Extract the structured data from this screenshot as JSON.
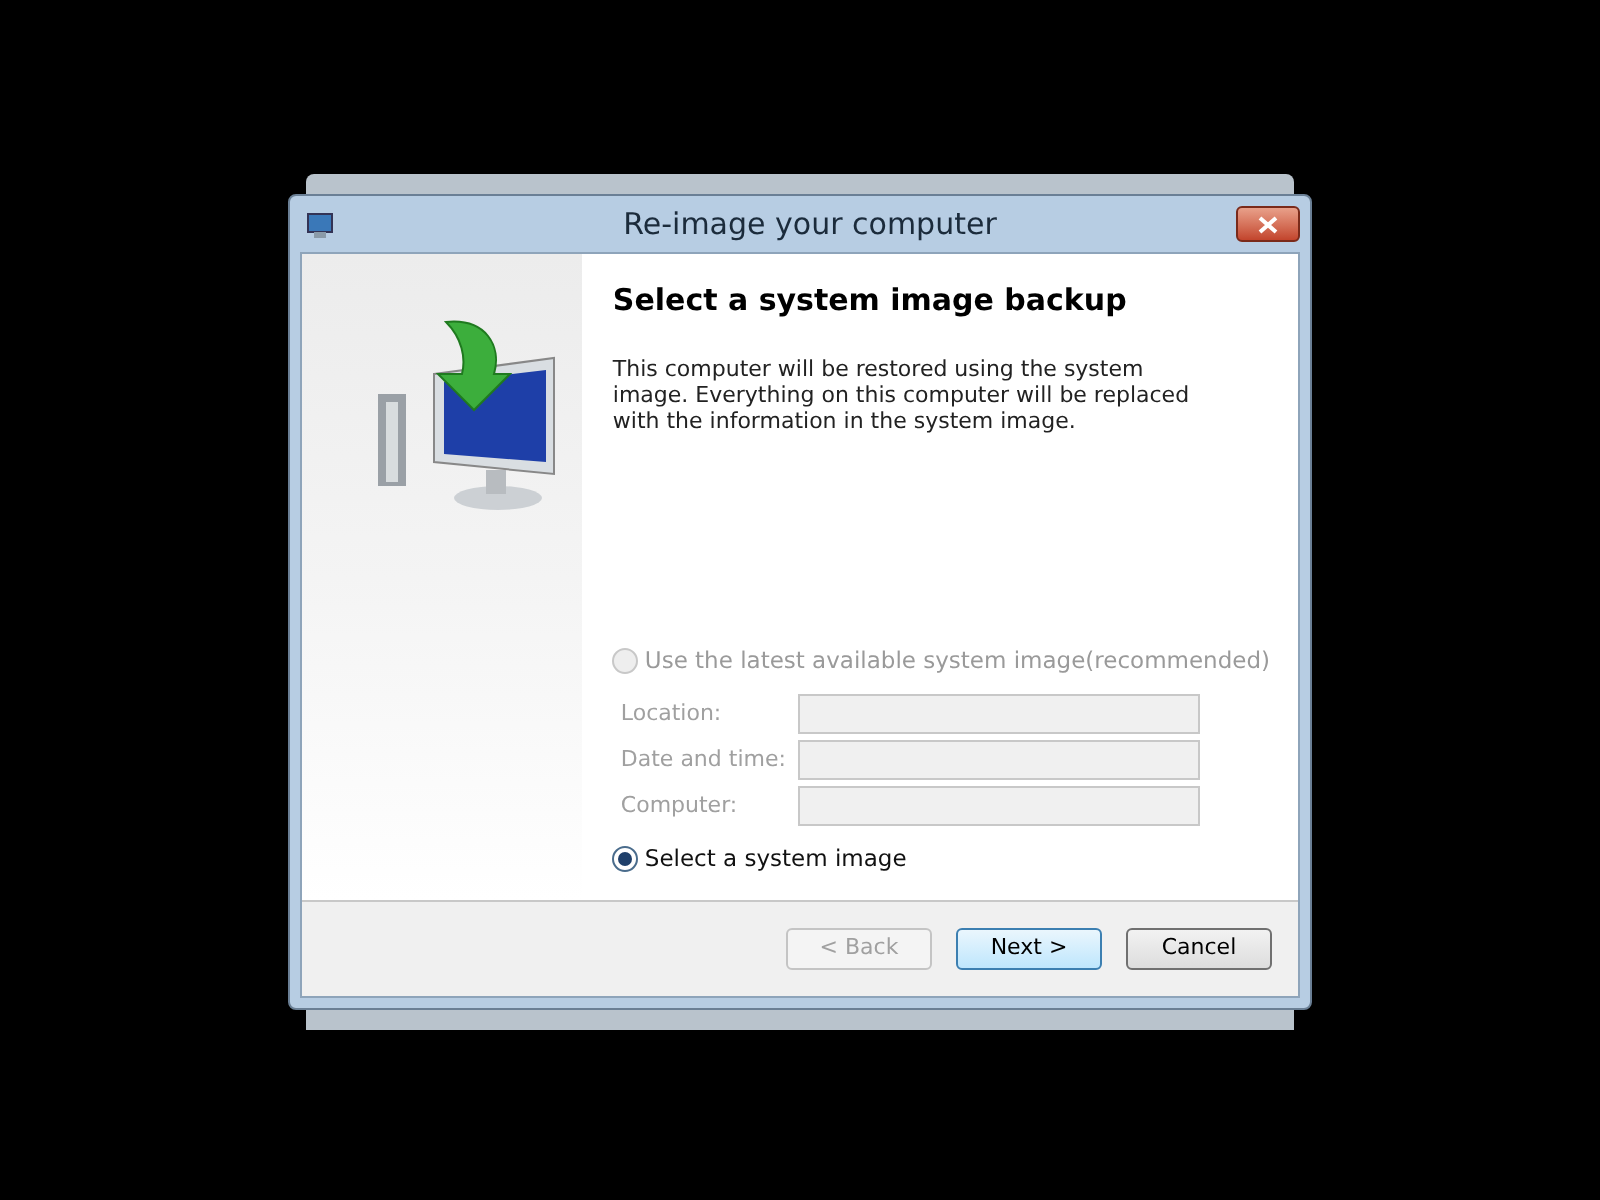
{
  "window": {
    "title": "Re-image your computer"
  },
  "heading": "Select a system image backup",
  "description": "This computer will be restored using the system image. Everything on this computer will be replaced with the information in the system image.",
  "options": [
    {
      "label": "Use the latest available system image(recommended)",
      "selected": false,
      "disabled": true
    },
    {
      "label": "Select a system image",
      "selected": true,
      "disabled": false
    }
  ],
  "fields": [
    {
      "label": "Location:",
      "disabled": true
    },
    {
      "label": "Date and time:",
      "disabled": true
    },
    {
      "label": "Computer:",
      "disabled": true
    }
  ],
  "buttons": [
    {
      "label": "< Back",
      "disabled": true,
      "default": false
    },
    {
      "label": "Next >",
      "disabled": false,
      "default": true
    },
    {
      "label": "Cancel",
      "disabled": false,
      "default": false
    }
  ]
}
